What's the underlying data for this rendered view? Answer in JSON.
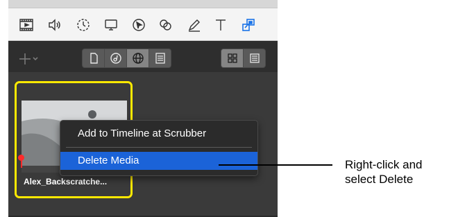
{
  "toolbar": {
    "icons": [
      "filmstrip-icon",
      "audio-icon",
      "speed-icon",
      "display-icon",
      "cursor-icon",
      "color-icon",
      "pen-icon",
      "text-icon",
      "picture-in-picture-icon"
    ],
    "accent_color": "#1a73e8"
  },
  "library_header": {
    "add_button": "+",
    "source_buttons": [
      "media-icon",
      "music-icon",
      "globe-icon",
      "calendar-icon"
    ],
    "active_source_index": 2,
    "view_buttons": [
      "grid-view-icon",
      "list-view-icon"
    ],
    "active_view_index": 0
  },
  "clip": {
    "name": "Alex_Backscratche...",
    "highlight_color": "#ffe900"
  },
  "context_menu": {
    "items": [
      {
        "label": "Add to Timeline at Scrubber",
        "selected": false
      },
      {
        "label": "Delete Media",
        "selected": true
      }
    ],
    "selection_color": "#1b63d8"
  },
  "callout": {
    "line1": "Right-click and",
    "line2": "select Delete"
  }
}
